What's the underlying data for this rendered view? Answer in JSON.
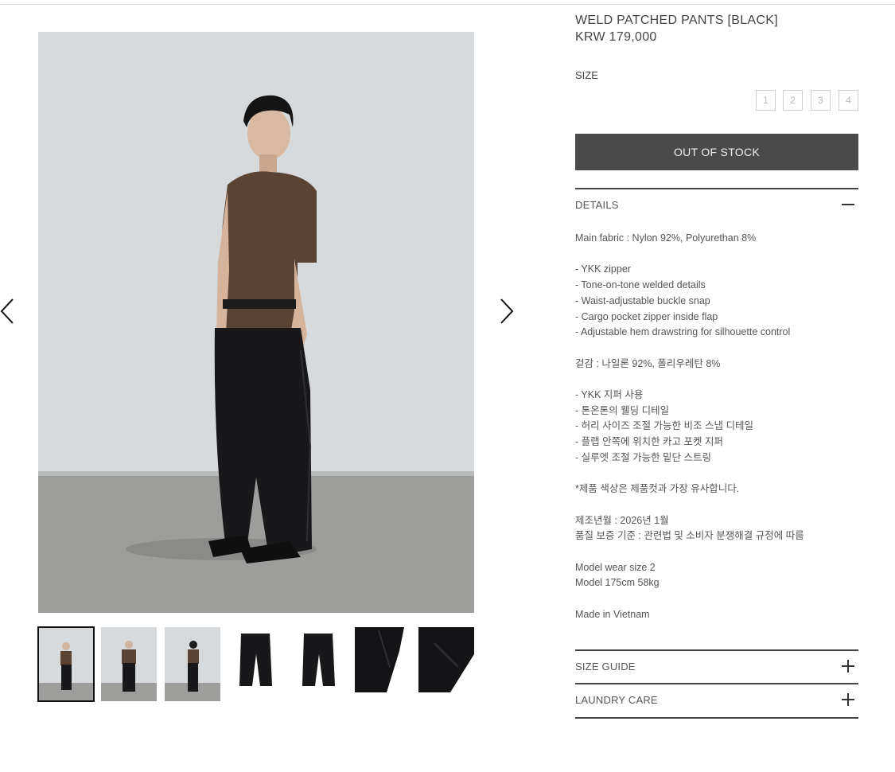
{
  "gallery": {
    "prev_icon": "chevron-left-icon",
    "next_icon": "chevron-right-icon",
    "thumbnails": [
      {
        "name": "thumb-model-front",
        "active": true
      },
      {
        "name": "thumb-model-front-2",
        "active": false
      },
      {
        "name": "thumb-model-side",
        "active": false
      },
      {
        "name": "thumb-pants-front",
        "active": false
      },
      {
        "name": "thumb-pants-back",
        "active": false
      },
      {
        "name": "thumb-detail-1",
        "active": false
      },
      {
        "name": "thumb-detail-2",
        "active": false
      }
    ]
  },
  "product": {
    "name": "WELD PATCHED PANTS [BLACK]",
    "price": "KRW 179,000"
  },
  "size": {
    "label": "SIZE",
    "options": [
      "1",
      "2",
      "3",
      "4"
    ]
  },
  "buy_button": {
    "label": "OUT OF STOCK"
  },
  "details": {
    "title": "DETAILS",
    "icon": "minus-icon",
    "lines": [
      "Main fabric : Nylon 92%, Polyurethan 8%",
      "",
      "- YKK zipper",
      "- Tone-on-tone welded details",
      "- Waist-adjustable buckle snap",
      "- Cargo pocket zipper inside flap",
      "- Adjustable hem drawstring for silhouette control",
      "",
      "겉감 : 나일론 92%, 폴리우레탄 8%",
      "",
      "- YKK 지퍼 사용",
      "- 톤온톤의 웰딩 디테일",
      "- 허리 사이즈 조절 가능한 비조 스냅 디테일",
      "- 플랩 안쪽에 위치한 카고 포켓 지퍼",
      "- 실루엣 조절 가능한 밑단 스트링",
      "",
      "*제품 색상은 제품컷과 가장 유사합니다.",
      "",
      "제조년월 : 2026년 1월",
      "품질 보증 기준 : 관련법 및 소비자 분쟁해결 규정에 따름",
      "",
      "Model wear size 2",
      "Model 175cm 58kg",
      "",
      "Made in Vietnam"
    ]
  },
  "size_guide": {
    "title": "SIZE GUIDE",
    "icon": "plus-icon"
  },
  "laundry_care": {
    "title": "LAUNDRY CARE",
    "icon": "plus-icon"
  },
  "colors": {
    "button_bg": "#4a4a4a",
    "wall": "#d5dadd",
    "floor": "#9c9c9a",
    "shirt": "#5a4232",
    "pants": "#17171a"
  }
}
